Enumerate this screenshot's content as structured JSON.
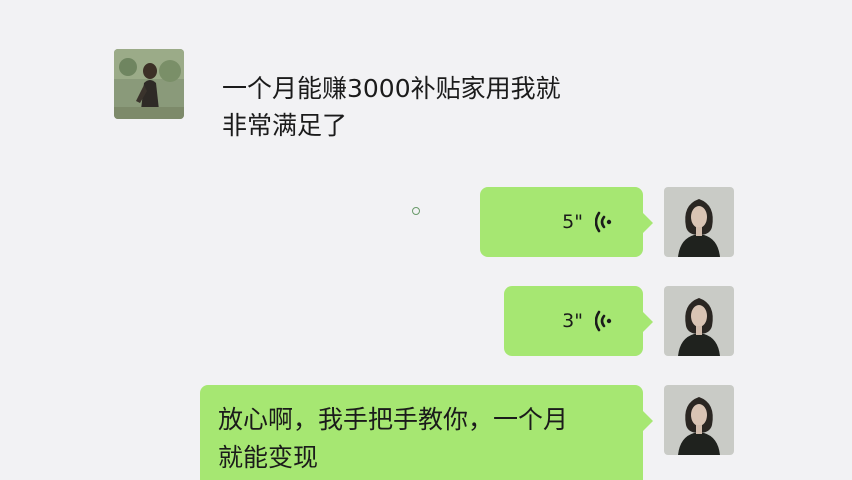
{
  "messages": [
    {
      "side": "in",
      "type": "text",
      "text_line1": "一个月能赚3000补贴家用我就",
      "text_line2": "非常满足了"
    },
    {
      "side": "out",
      "type": "voice",
      "duration": "5\""
    },
    {
      "side": "out",
      "type": "voice",
      "duration": "3\""
    },
    {
      "side": "out",
      "type": "text",
      "text_line1": "放心啊，我手把手教你，一个月",
      "text_line2": "就能变现"
    }
  ],
  "icons": {
    "voice": "voice-wave-icon",
    "avatar_in": "contact-avatar",
    "avatar_out": "self-avatar"
  },
  "colors": {
    "background": "#f2f2f4",
    "bubble_out": "#a6e772"
  }
}
